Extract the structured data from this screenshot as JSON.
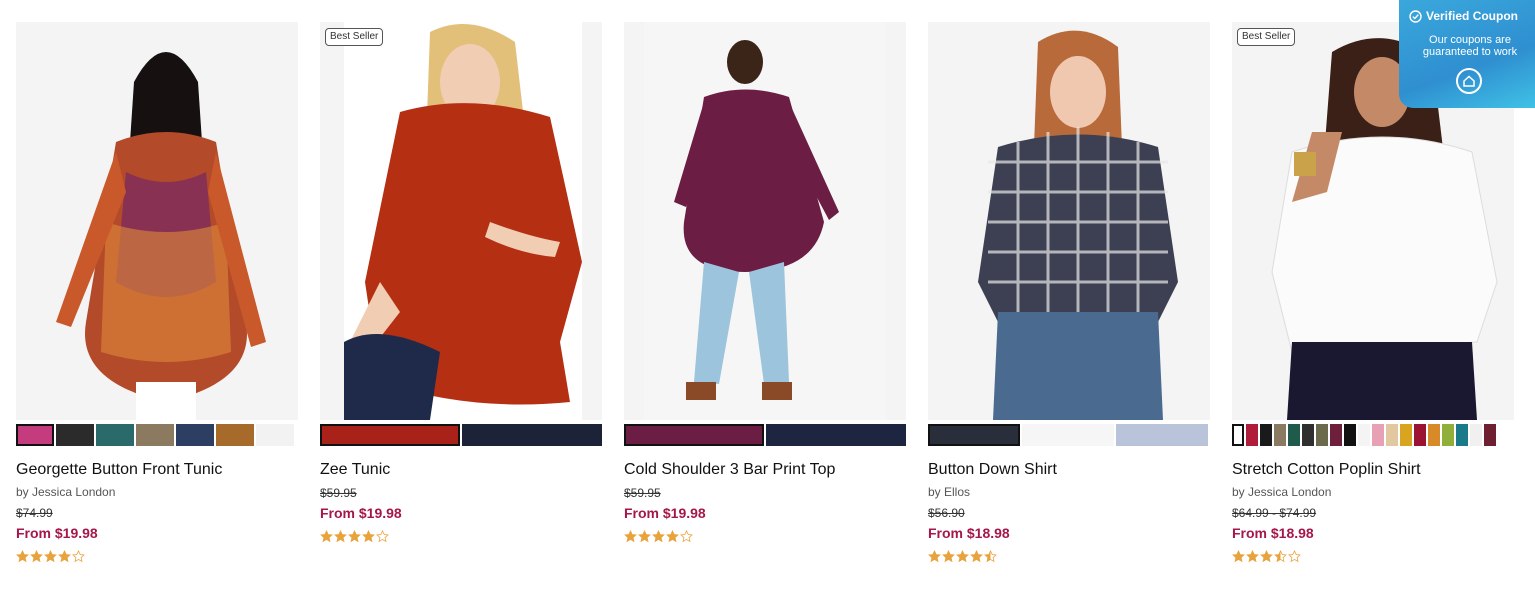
{
  "products": [
    {
      "title": "Georgette Button Front Tunic",
      "brand": "by Jessica London",
      "original_price": "$74.99",
      "sale_price": "From $19.98",
      "rating_stars": 4,
      "badge": "",
      "image_icon": "product-photo",
      "swatches": [
        "#c43c7e",
        "#2b2b2b",
        "#2a6a6a",
        "#8c7a60",
        "#2c3f63",
        "#a66a2a",
        "#f2f2f2"
      ]
    },
    {
      "title": "Zee Tunic",
      "brand": "",
      "original_price": "$59.95",
      "sale_price": "From $19.98",
      "rating_stars": 4,
      "badge": "Best Seller",
      "image_icon": "product-photo",
      "swatches": [
        "#a8221a",
        "#1c2238"
      ]
    },
    {
      "title": "Cold Shoulder 3 Bar Print Top",
      "brand": "",
      "original_price": "$59.95",
      "sale_price": "From $19.98",
      "rating_stars": 4,
      "badge": "",
      "image_icon": "product-photo",
      "swatches": [
        "#6b1d44",
        "#1e2540"
      ]
    },
    {
      "title": "Button Down Shirt",
      "brand": "by Ellos",
      "original_price": "$56.90",
      "sale_price": "From $18.98",
      "rating_stars": 4.5,
      "badge": "",
      "image_icon": "product-photo",
      "swatches": [
        "#2a2d3a",
        "#f6f6f6",
        "#b9c3da"
      ]
    },
    {
      "title": "Stretch Cotton Poplin Shirt",
      "brand": "by Jessica London",
      "original_price": "$64.99 - $74.99",
      "sale_price": "From $18.98",
      "rating_stars": 3.5,
      "badge": "Best Seller",
      "image_icon": "product-photo",
      "swatches": [
        "#ffffff",
        "#b01d3a",
        "#1a1a1a",
        "#8a7a62",
        "#1f5a4a",
        "#2f2f2f",
        "#6c6a4c",
        "#6e1f3c",
        "#111111",
        "#f4f4f4",
        "#e8a0b4",
        "#e2c8a0",
        "#d9a520",
        "#9c1232",
        "#d98a28",
        "#8fae3a",
        "#1a7a8a",
        "#f0f0f0",
        "#6e2030"
      ]
    }
  ],
  "coupon": {
    "title": "Verified Coupon",
    "subtitle": "Our coupons are guaranteed to work",
    "check_icon": "check-circle-icon",
    "home_icon": "home-icon"
  },
  "colors": {
    "sale_price": "#a5174a",
    "star": "#e8a33d",
    "coupon_bg": "#3aa8dc"
  }
}
